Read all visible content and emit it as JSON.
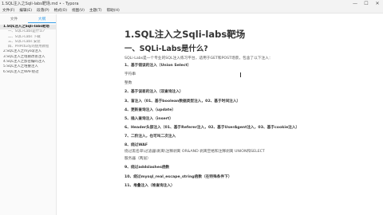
{
  "window": {
    "title": "1.SQL注入之Sqli-labs靶场.md • - Typora",
    "min": "—",
    "max": "☐",
    "close": "✕"
  },
  "menu": [
    "文件(F)",
    "编辑(E)",
    "段落(P)",
    "格式(O)",
    "视图(V)",
    "主题(T)",
    "帮助(H)"
  ],
  "sidebar": {
    "tabs": [
      "文件",
      "大纲"
    ],
    "active_tab": 1,
    "outline": [
      {
        "text": "1.SQL注入之Sqli-labs靶场",
        "level": 1,
        "selected": true
      },
      {
        "text": "一、SQLi-Labs是什么?",
        "level": 2,
        "selected": false
      },
      {
        "text": "二、SQLi-Labs 下载",
        "level": 2,
        "selected": false
      },
      {
        "text": "三、SQLi-Labs 安装",
        "level": 2,
        "selected": false
      },
      {
        "text": "四、PHPstudy的使用教程",
        "level": 2,
        "selected": false
      },
      {
        "text": "2.SQL注入之mysql注入",
        "level": 1,
        "selected": false
      },
      {
        "text": "3.SQL注入之增删改查注入",
        "level": 1,
        "selected": false
      },
      {
        "text": "4.SQL注入之加密编码注入",
        "level": 1,
        "selected": false
      },
      {
        "text": "5.SQL注入之堆叠注入",
        "level": 1,
        "selected": false
      },
      {
        "text": "6.SQL注入之WAF绕过",
        "level": 1,
        "selected": false
      }
    ]
  },
  "doc": {
    "h1": "1.SQL注入之Sqli-labs靶场",
    "h2": "一、SQLi-Labs是什么?",
    "lines": [
      {
        "text": "SQLi-Labs是一个专业的SQL注入练习平台，适用于GET和POST场景，包含了以下注入：",
        "bold": false,
        "tight": true
      },
      {
        "text": "1、基于错误的注入（Union Select）",
        "bold": true
      },
      {
        "text": "字符串",
        "bold": false
      },
      {
        "text": "整数",
        "bold": false
      },
      {
        "text": "2、基于误差的注入（双查询注入）",
        "bold": true
      },
      {
        "text": "3、盲注入（01、基于boolean数据类型注入，02、基于时间注入）",
        "bold": true
      },
      {
        "text": "4、更新查询注入（update）",
        "bold": true
      },
      {
        "text": "5、插入查询注入（insert）",
        "bold": true
      },
      {
        "text": "6、Header头部注入（01、基于Referer注入，02、基于UserAgent注入，03、基于cookie注入）",
        "bold": true
      },
      {
        "text": "7、二阶注入，也可叫二次注入",
        "bold": true
      },
      {
        "text": "8、绕过WAF",
        "bold": true
      },
      {
        "text": "绕过黑名单\\过滤器\\剥离\\注释剥离 OR&AND 剥离空格和注释剥离 UNION和SELECT",
        "bold": false,
        "tight": true
      },
      {
        "text": "服务器（两层）",
        "bold": false
      },
      {
        "text": "9、绕过addslashes函数",
        "bold": true
      },
      {
        "text": "10、绕过mysql_real_escape_string函数（在特殊条件下）",
        "bold": true
      },
      {
        "text": "11、堆叠注入（堆查询注入）",
        "bold": true
      }
    ]
  }
}
